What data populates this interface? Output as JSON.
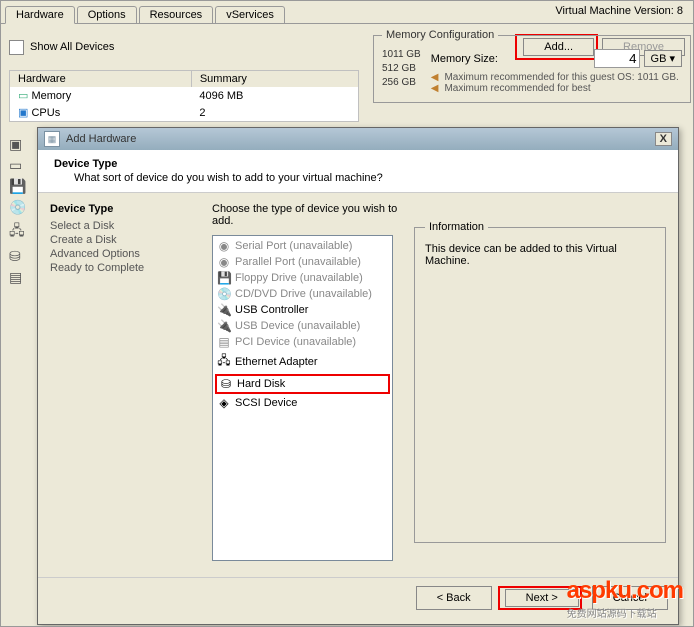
{
  "tabs": {
    "hardware": "Hardware",
    "options": "Options",
    "resources": "Resources",
    "vservices": "vServices"
  },
  "vm_version_label": "Virtual Machine Version: 8",
  "show_all": "Show All Devices",
  "buttons": {
    "add": "Add...",
    "remove": "Remove",
    "back": "< Back",
    "next": "Next >",
    "cancel": "Cancel"
  },
  "hw_table": {
    "col1": "Hardware",
    "col2": "Summary",
    "rows": [
      {
        "name": "Memory",
        "val": "4096 MB"
      },
      {
        "name": "CPUs",
        "val": "2"
      }
    ]
  },
  "mem": {
    "group_title": "Memory Configuration",
    "size_label": "Memory Size:",
    "size_value": "4",
    "unit": "GB ▾",
    "ticks": [
      "1011 GB",
      "512 GB",
      "256 GB"
    ],
    "rec1": "Maximum recommended for this guest OS: 1011 GB.",
    "rec2": "Maximum recommended for best"
  },
  "dialog": {
    "title": "Add Hardware",
    "header_title": "Device Type",
    "header_sub": "What sort of device do you wish to add to your virtual machine?",
    "left_title": "Device Type",
    "steps": [
      "Select a Disk",
      "Create a Disk",
      "Advanced Options",
      "Ready to Complete"
    ],
    "center_instr": "Choose the type of device you wish to add.",
    "devices": [
      {
        "ico": "◉",
        "label": "Serial Port (unavailable)",
        "dis": true
      },
      {
        "ico": "◉",
        "label": "Parallel Port (unavailable)",
        "dis": true
      },
      {
        "ico": "💾",
        "label": "Floppy Drive (unavailable)",
        "dis": true
      },
      {
        "ico": "💿",
        "label": "CD/DVD Drive (unavailable)",
        "dis": true
      },
      {
        "ico": "🔌",
        "label": "USB Controller",
        "dis": false
      },
      {
        "ico": "🔌",
        "label": "USB Device (unavailable)",
        "dis": true
      },
      {
        "ico": "▤",
        "label": "PCI Device (unavailable)",
        "dis": true
      },
      {
        "ico": "🖧",
        "label": "Ethernet Adapter",
        "dis": false
      },
      {
        "ico": "⛁",
        "label": "Hard Disk",
        "dis": false,
        "hl": true
      },
      {
        "ico": "◈",
        "label": "SCSI Device",
        "dis": false
      }
    ],
    "info_title": "Information",
    "info_text": "This device can be added to this Virtual Machine."
  },
  "watermark": {
    "main": "aspku.com",
    "sub": "免费网站源码下载站"
  }
}
